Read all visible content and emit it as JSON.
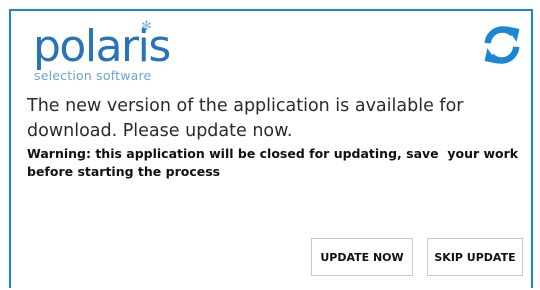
{
  "logo": {
    "word": "polaris",
    "star": "✻",
    "subtitle": "selection software"
  },
  "icons": {
    "refresh": "refresh-icon"
  },
  "colors": {
    "accent": "#1c86d4",
    "brand": "#2a73b8",
    "subtitle": "#6aa6d6"
  },
  "dialog": {
    "message": "The new version of the application is available for download. Please update now.",
    "warning": "Warning: this application will be closed for updating, save  your work before starting the process"
  },
  "buttons": {
    "update_now": "UPDATE NOW",
    "skip_update": "SKIP UPDATE"
  }
}
